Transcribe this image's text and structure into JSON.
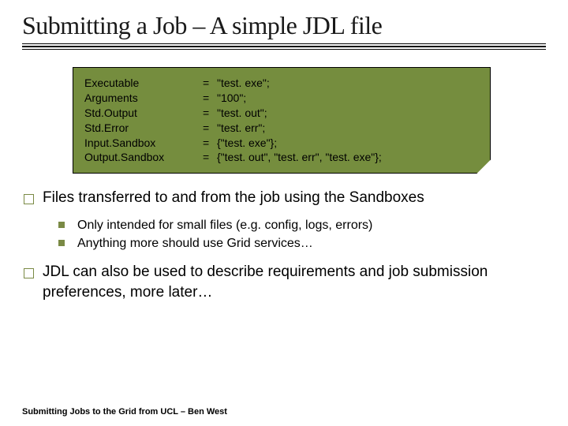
{
  "title": "Submitting a Job – A simple JDL file",
  "code": {
    "rows": [
      {
        "key": "Executable",
        "eq": "=",
        "val": "\"test. exe\";"
      },
      {
        "key": "Arguments",
        "eq": "=",
        "val": "\"100\";"
      },
      {
        "key": "Std.Output",
        "eq": "=",
        "val": "\"test. out\";"
      },
      {
        "key": "Std.Error",
        "eq": "=",
        "val": "\"test. err\";"
      },
      {
        "key": "Input.Sandbox",
        "eq": "=",
        "val": "{\"test. exe\"};"
      },
      {
        "key": "Output.Sandbox",
        "eq": "=",
        "val": "{\"test. out\", \"test. err\", \"test. exe\"};"
      }
    ]
  },
  "bullets": [
    {
      "text": "Files transferred to and from the job using the Sandboxes",
      "subs": [
        "Only intended for small files (e.g. config, logs, errors)",
        "Anything more should use Grid services…"
      ]
    },
    {
      "text": "JDL can also be used to describe requirements and job submission preferences, more later…",
      "subs": []
    }
  ],
  "footer": "Submitting Jobs to the Grid from UCL – Ben West"
}
